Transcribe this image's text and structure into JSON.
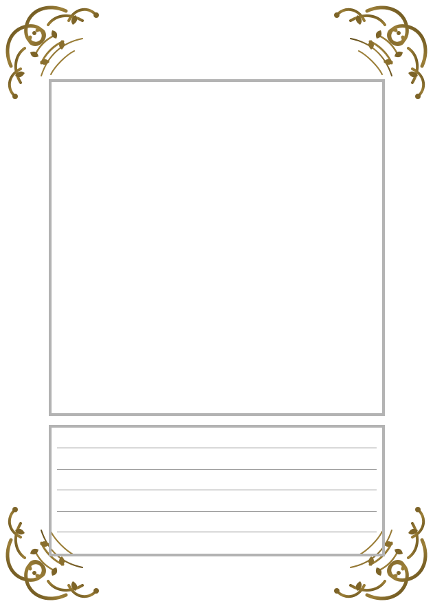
{
  "card": {
    "frame_color": "#7d6428",
    "frame_highlight": "#a88a3e",
    "panel_border_color": "#b3b3b3",
    "writing_line_color": "#8c8c8c",
    "writing_line_count": 5,
    "corner_ornament": "baroque-scroll-ornament"
  }
}
